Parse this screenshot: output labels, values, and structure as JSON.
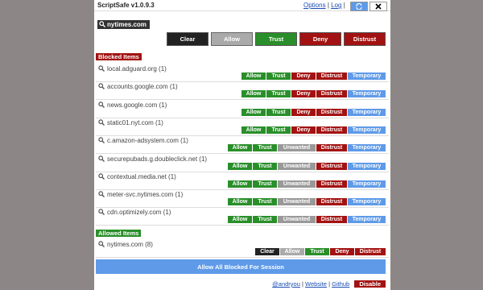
{
  "app": {
    "title": "ScriptSafe v1.0.9.3",
    "links": {
      "options": "Options",
      "log": "Log"
    },
    "current_domain": "nytimes.com"
  },
  "main_buttons": {
    "clear": "Clear",
    "allow": "Allow",
    "trust": "Trust",
    "deny": "Deny",
    "distrust": "Distrust"
  },
  "blocked_section": {
    "label": "Blocked Items",
    "items": [
      {
        "name": "local.adguard.org (1)",
        "actions": [
          "Allow",
          "Trust",
          "Deny",
          "Distrust",
          "Temporary"
        ]
      },
      {
        "name": "accounts.google.com (1)",
        "actions": [
          "Allow",
          "Trust",
          "Deny",
          "Distrust",
          "Temporary"
        ]
      },
      {
        "name": "news.google.com (1)",
        "actions": [
          "Allow",
          "Trust",
          "Deny",
          "Distrust",
          "Temporary"
        ]
      },
      {
        "name": "static01.nyt.com (1)",
        "actions": [
          "Allow",
          "Trust",
          "Deny",
          "Distrust",
          "Temporary"
        ]
      },
      {
        "name": "c.amazon-adsystem.com (1)",
        "actions": [
          "Allow",
          "Trust",
          "Unwanted",
          "Distrust",
          "Temporary"
        ]
      },
      {
        "name": "securepubads.g.doubleclick.net (1)",
        "actions": [
          "Allow",
          "Trust",
          "Unwanted",
          "Distrust",
          "Temporary"
        ]
      },
      {
        "name": "contextual.media.net (1)",
        "actions": [
          "Allow",
          "Trust",
          "Unwanted",
          "Distrust",
          "Temporary"
        ]
      },
      {
        "name": "meter-svc.nytimes.com (1)",
        "actions": [
          "Allow",
          "Trust",
          "Unwanted",
          "Distrust",
          "Temporary"
        ]
      },
      {
        "name": "cdn.optimizely.com (1)",
        "actions": [
          "Allow",
          "Trust",
          "Unwanted",
          "Distrust",
          "Temporary"
        ]
      }
    ]
  },
  "allowed_section": {
    "label": "Allowed Items",
    "items": [
      {
        "name": "nytimes.com (8)",
        "actions": [
          "Clear",
          "Allow",
          "Trust",
          "Deny",
          "Distrust"
        ]
      }
    ]
  },
  "allow_all_label": "Allow All Blocked For Session",
  "footer": {
    "author": "@andryou",
    "website": "Website",
    "github": "Github",
    "disable": "Disable"
  },
  "icons": {
    "search": "search-icon",
    "refresh": "refresh-icon",
    "close": "close-icon"
  },
  "colors": {
    "green": "#2a8f2a",
    "red": "#a31212",
    "blue": "#5e9ae8",
    "grey": "#aaaaaa",
    "dark": "#222222"
  }
}
